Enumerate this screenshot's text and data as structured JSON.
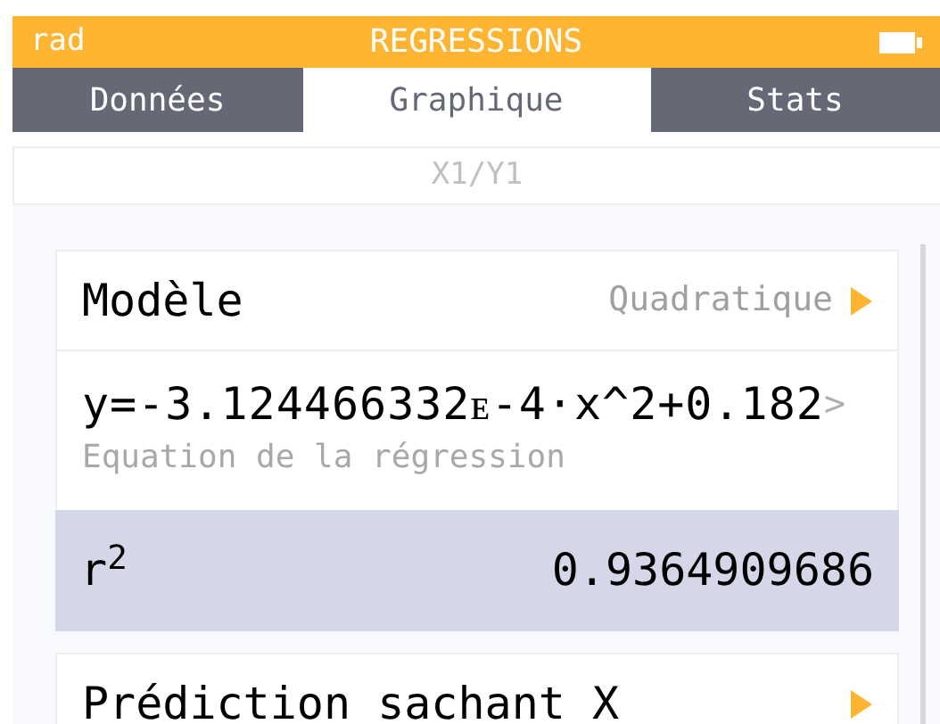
{
  "header": {
    "angle_mode": "rad",
    "title": "REGRESSIONS"
  },
  "tabs": [
    {
      "label": "Données",
      "selected": false
    },
    {
      "label": "Graphique",
      "selected": true
    },
    {
      "label": "Stats",
      "selected": false
    }
  ],
  "series_title": "X1/Y1",
  "rows": [
    {
      "kind": "choice",
      "label": "Modèle",
      "value": "Quadratique",
      "selected": false
    },
    {
      "kind": "equation",
      "value": "y=-3.124466332ᴇ-4·x^2+0.182",
      "more": ">",
      "caption": "Equation de la régression",
      "selected": false
    },
    {
      "kind": "value",
      "label": "r$^{2}$",
      "value": "0.9364909686",
      "selected": true
    },
    {
      "kind": "choice",
      "label": "Prédiction sachant X",
      "selected": false
    }
  ]
}
